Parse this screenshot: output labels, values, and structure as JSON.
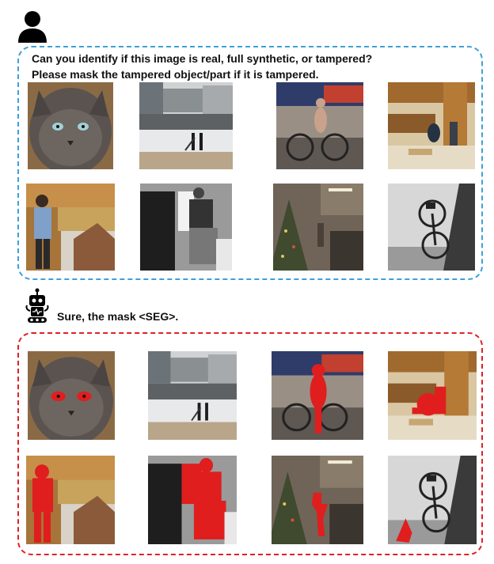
{
  "user": {
    "icon": "user-icon"
  },
  "prompt": {
    "line1": "Can you identify if this image is real, full synthetic, or tampered?",
    "line2": "Please mask the tampered object/part if it is tampered."
  },
  "assistant": {
    "icon": "robot-icon",
    "reply": "Sure, the mask <SEG>."
  },
  "input_images": [
    {
      "name": "cat-photo"
    },
    {
      "name": "beach-surfers-photo"
    },
    {
      "name": "woman-bicycle-photo"
    },
    {
      "name": "kitchen-people-photo"
    },
    {
      "name": "woman-gingerbread-photo"
    },
    {
      "name": "fridge-person-photo"
    },
    {
      "name": "kitchen-christmas-tree-photo"
    },
    {
      "name": "hanging-bicycle-photo"
    }
  ],
  "mask_color": "#e01e1e",
  "colors": {
    "prompt_border": "#3fa0d8",
    "answer_border": "#e0202a"
  }
}
